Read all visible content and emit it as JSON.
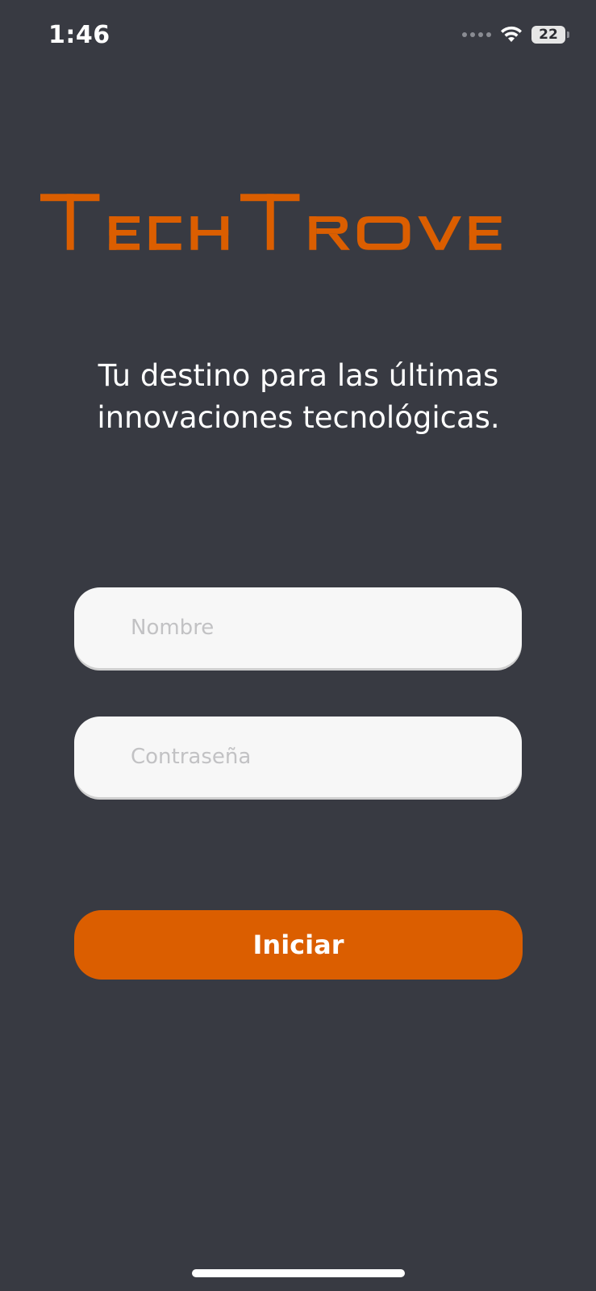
{
  "status_bar": {
    "time": "1:46",
    "battery_level": "22",
    "icons": [
      "signal-dots-icon",
      "wifi-icon",
      "battery-icon"
    ]
  },
  "brand": {
    "logo_text": "TechTrove",
    "logo_color": "#db5e00"
  },
  "tagline": {
    "line1": "Tu destino para las últimas",
    "line2": "innovaciones tecnológicas."
  },
  "form": {
    "username_placeholder": "Nombre",
    "username_value": "",
    "password_placeholder": "Contraseña",
    "password_value": ""
  },
  "actions": {
    "start_label": "Iniciar"
  },
  "colors": {
    "background": "#383a42",
    "accent": "#db5e00",
    "field_background": "#f7f7f7",
    "placeholder": "#c2c2c4"
  }
}
